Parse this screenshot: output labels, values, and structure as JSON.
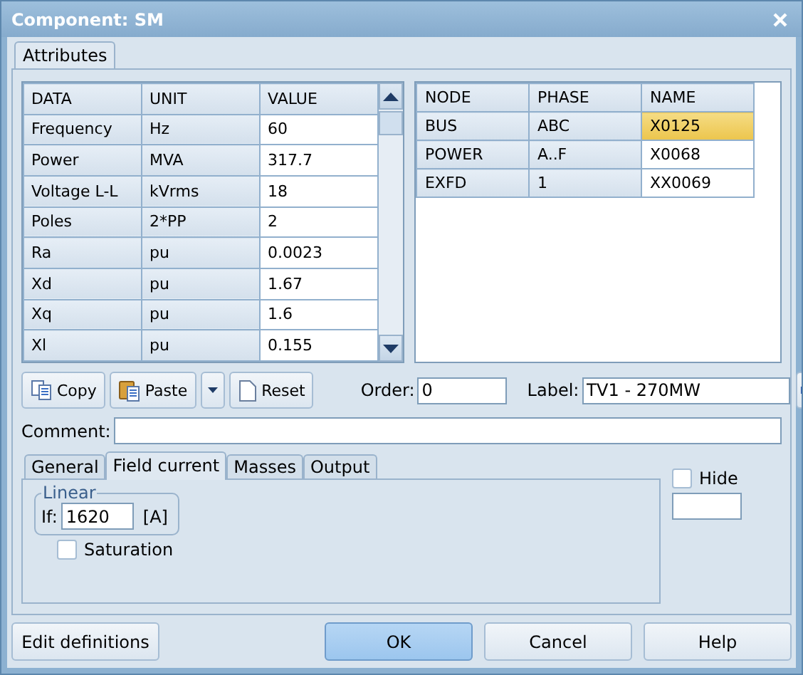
{
  "window": {
    "title": "Component: SM"
  },
  "tabs": [
    {
      "label": "Attributes",
      "selected": true
    }
  ],
  "data_table": {
    "columns": [
      "DATA",
      "UNIT",
      "VALUE"
    ],
    "rows": [
      {
        "data": "Frequency",
        "unit": "Hz",
        "value": "60"
      },
      {
        "data": "Power",
        "unit": "MVA",
        "value": "317.7"
      },
      {
        "data": "Voltage L-L",
        "unit": "kVrms",
        "value": "18"
      },
      {
        "data": "Poles",
        "unit": "2*PP",
        "value": "2"
      },
      {
        "data": "Ra",
        "unit": "pu",
        "value": "0.0023"
      },
      {
        "data": "Xd",
        "unit": "pu",
        "value": "1.67"
      },
      {
        "data": "Xq",
        "unit": "pu",
        "value": "1.6"
      },
      {
        "data": "Xl",
        "unit": "pu",
        "value": "0.155"
      }
    ]
  },
  "node_table": {
    "columns": [
      "NODE",
      "PHASE",
      "NAME"
    ],
    "rows": [
      {
        "node": "BUS",
        "phase": "ABC",
        "name": "X0125",
        "selected": true
      },
      {
        "node": "POWER",
        "phase": "A..F",
        "name": "X0068",
        "selected": false
      },
      {
        "node": "EXFD",
        "phase": "1",
        "name": "XX0069",
        "selected": false
      }
    ]
  },
  "toolbar": {
    "copy": "Copy",
    "paste": "Paste",
    "reset": "Reset",
    "order_label": "Order:",
    "order": "0",
    "label_label": "Label:",
    "label": "TV1 - 270MW"
  },
  "comment": {
    "label": "Comment:"
  },
  "sub_tabs": [
    {
      "label": "General",
      "selected": false
    },
    {
      "label": "Field current",
      "selected": true
    },
    {
      "label": "Masses",
      "selected": false
    },
    {
      "label": "Output",
      "selected": false
    }
  ],
  "field_current": {
    "group": "Linear",
    "if_label": "If:",
    "if_value": "1620",
    "unit": "[A]",
    "saturation": {
      "label": "Saturation",
      "checked": false
    }
  },
  "hide": {
    "label": "Hide",
    "checked": false
  },
  "buttons": [
    {
      "label": "Edit definitions",
      "default": false
    },
    {
      "label": "OK",
      "default": true
    },
    {
      "label": "Cancel",
      "default": false
    },
    {
      "label": "Help",
      "default": false
    }
  ]
}
